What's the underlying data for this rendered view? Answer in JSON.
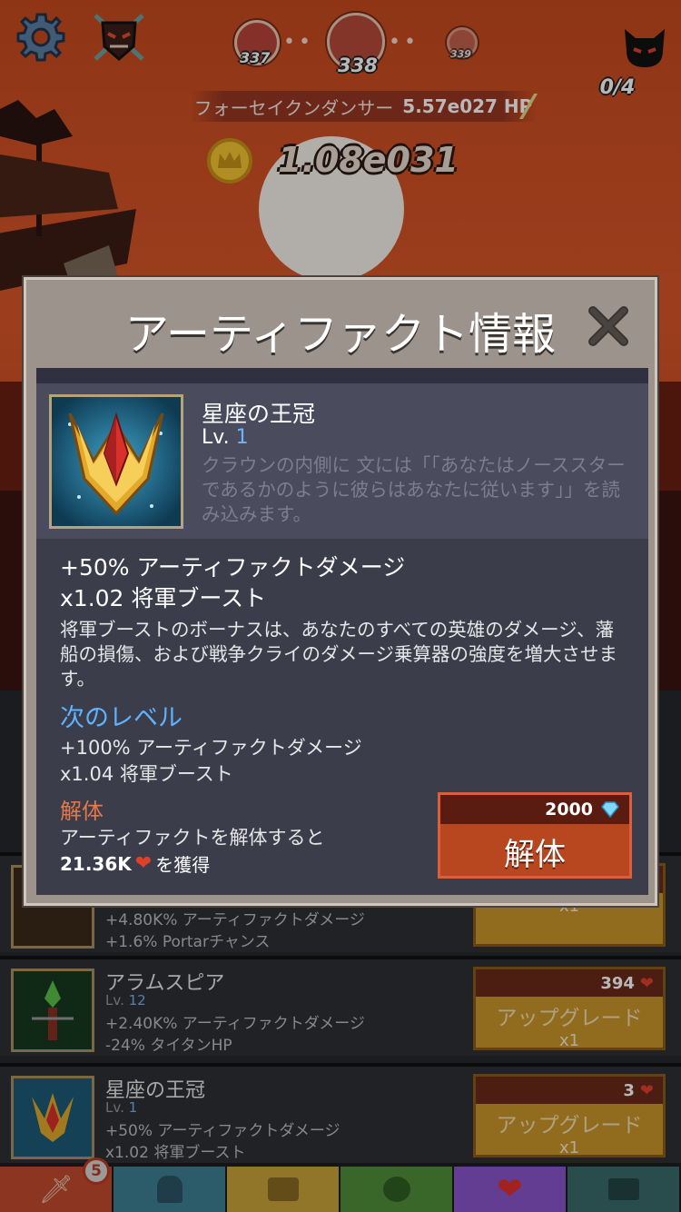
{
  "hud": {
    "stage_prev": "337",
    "stage_current": "338",
    "stage_next": "339",
    "enemy_counter": "0/4",
    "boss_name": "フォーセイクンダンサー",
    "boss_hp": "5.57e027 HP",
    "gold": "1.08e031"
  },
  "modal": {
    "title": "アーティファクト情報",
    "artifact_name": "星座の王冠",
    "level_label": "Lv.",
    "level_value": "1",
    "description": "クラウンの内側に 文には「「あなたはノーススターであるかのように彼らはあなたに従います」」を読み込みます。",
    "bonus_1": "+50% アーティファクトダメージ",
    "bonus_2": "x1.02 将軍ブースト",
    "bonus_desc": "将軍ブーストのボーナスは、あなたのすべての英雄のダメージ、藩船の損傷、および戦争クライのダメージ乗算器の強度を増大させます。",
    "next_level_heading": "次のレベル",
    "next_1": "+100% アーティファクトダメージ",
    "next_2": "x1.04 将軍ブースト",
    "disassemble_heading": "解体",
    "disassemble_text": "アーティファクトを解体すると",
    "disassemble_reward_amount": "21.36K",
    "disassemble_reward_suffix": "を獲得",
    "disassemble_cost": "2000",
    "disassemble_button": "解体"
  },
  "list": {
    "rows": [
      {
        "title": "",
        "level_label": "",
        "level": "",
        "line1": "+4.80K% アーティファクトダメージ",
        "line2": "+1.6% Portarチャンス",
        "cost": "",
        "button": "",
        "mult": "x1"
      },
      {
        "title": "アラムスピア",
        "level_label": "Lv.",
        "level": "12",
        "line1": "+2.40K% アーティファクトダメージ",
        "line2": "-24% タイタンHP",
        "cost": "394",
        "button": "アップグレード",
        "mult": "x1"
      },
      {
        "title": "星座の王冠",
        "level_label": "Lv.",
        "level": "1",
        "line1": "+50% アーティファクトダメージ",
        "line2": "x1.02 将軍ブースト",
        "cost": "3",
        "button": "アップグレード",
        "mult": "x1"
      }
    ]
  },
  "tabs": [
    {
      "name": "sword",
      "color": "#c24a2e",
      "badge": "5"
    },
    {
      "name": "hero",
      "color": "#3e7f94"
    },
    {
      "name": "equipment",
      "color": "#c9a23a"
    },
    {
      "name": "pet",
      "color": "#4f8f3a"
    },
    {
      "name": "artifact",
      "color": "#8a55c9"
    },
    {
      "name": "shop",
      "color": "#3a6b6b"
    }
  ],
  "colors": {
    "accent_blue": "#5fb2ff",
    "disassemble_orange": "#e4784a",
    "disassemble_button": "#b8461f",
    "upgrade_gold": "#c9962c"
  }
}
